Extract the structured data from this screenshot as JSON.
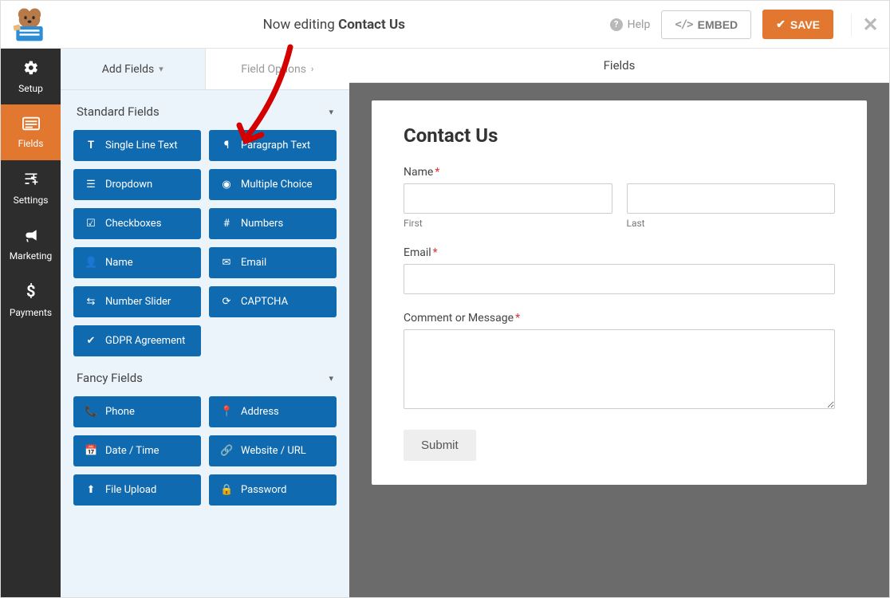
{
  "header": {
    "now_editing_prefix": "Now editing",
    "form_name": "Contact Us",
    "help_label": "Help",
    "embed_label": "EMBED",
    "save_label": "SAVE"
  },
  "sidenav": {
    "items": [
      {
        "id": "setup",
        "label": "Setup"
      },
      {
        "id": "fields",
        "label": "Fields"
      },
      {
        "id": "settings",
        "label": "Settings"
      },
      {
        "id": "marketing",
        "label": "Marketing"
      },
      {
        "id": "payments",
        "label": "Payments"
      }
    ],
    "active": "fields"
  },
  "panel": {
    "tabs": {
      "add_fields": "Add Fields",
      "field_options": "Field Options"
    },
    "banner": "Fields",
    "groups": [
      {
        "title": "Standard Fields",
        "fields": [
          {
            "icon": "text-icon",
            "label": "Single Line Text"
          },
          {
            "icon": "paragraph-icon",
            "label": "Paragraph Text"
          },
          {
            "icon": "dropdown-icon",
            "label": "Dropdown"
          },
          {
            "icon": "radio-icon",
            "label": "Multiple Choice"
          },
          {
            "icon": "checkbox-icon",
            "label": "Checkboxes"
          },
          {
            "icon": "hash-icon",
            "label": "Numbers"
          },
          {
            "icon": "user-icon",
            "label": "Name"
          },
          {
            "icon": "envelope-icon",
            "label": "Email"
          },
          {
            "icon": "slider-icon",
            "label": "Number Slider"
          },
          {
            "icon": "refresh-icon",
            "label": "CAPTCHA"
          },
          {
            "icon": "check-icon",
            "label": "GDPR Agreement"
          }
        ]
      },
      {
        "title": "Fancy Fields",
        "fields": [
          {
            "icon": "phone-icon",
            "label": "Phone"
          },
          {
            "icon": "marker-icon",
            "label": "Address"
          },
          {
            "icon": "calendar-icon",
            "label": "Date / Time"
          },
          {
            "icon": "link-icon",
            "label": "Website / URL"
          },
          {
            "icon": "upload-icon",
            "label": "File Upload"
          },
          {
            "icon": "lock-icon",
            "label": "Password"
          }
        ]
      }
    ]
  },
  "form_preview": {
    "title": "Contact Us",
    "name_label": "Name",
    "first_sublabel": "First",
    "last_sublabel": "Last",
    "email_label": "Email",
    "comment_label": "Comment or Message",
    "submit_label": "Submit"
  },
  "colors": {
    "accent": "#e27730",
    "chip": "#0f6ab0"
  },
  "icons": {
    "text-icon": "𝐓",
    "paragraph-icon": "¶",
    "dropdown-icon": "☰",
    "radio-icon": "◉",
    "checkbox-icon": "☑",
    "hash-icon": "#",
    "user-icon": "👤",
    "envelope-icon": "✉",
    "slider-icon": "⇆",
    "refresh-icon": "⟳",
    "check-icon": "✔",
    "phone-icon": "📞",
    "marker-icon": "📍",
    "calendar-icon": "📅",
    "link-icon": "🔗",
    "upload-icon": "⬆",
    "lock-icon": "🔒"
  }
}
